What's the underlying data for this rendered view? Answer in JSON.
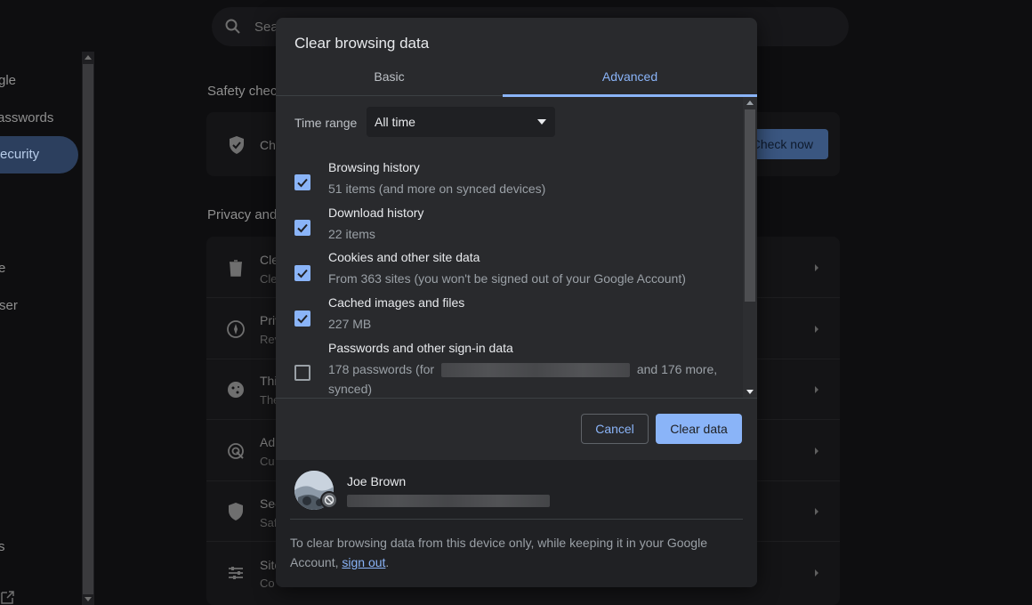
{
  "background": {
    "search_placeholder": "Sea",
    "sidebar_items": [
      "gle",
      "asswords",
      "ecurity",
      "e",
      "ser",
      "s"
    ],
    "safety_check_heading": "Safety chec",
    "safety_row_title": "Ch",
    "check_now_label": "Check now",
    "privacy_heading": "Privacy and",
    "privacy_rows": [
      {
        "title": "Cle",
        "sub": "Cle"
      },
      {
        "title": "Priv",
        "sub": "Rev"
      },
      {
        "title": "Thi",
        "sub": "The"
      },
      {
        "title": "Ad",
        "sub": "Cu"
      },
      {
        "title": "Sec",
        "sub": "Saf"
      },
      {
        "title": "Site",
        "sub": "Co"
      }
    ]
  },
  "dialog": {
    "title": "Clear browsing data",
    "tabs": [
      {
        "label": "Basic",
        "active": false
      },
      {
        "label": "Advanced",
        "active": true
      }
    ],
    "time_range": {
      "label": "Time range",
      "selected": "All time"
    },
    "items": [
      {
        "title": "Browsing history",
        "sub": "51 items (and more on synced devices)",
        "checked": true
      },
      {
        "title": "Download history",
        "sub": "22 items",
        "checked": true
      },
      {
        "title": "Cookies and other site data",
        "sub": "From 363 sites (you won't be signed out of your Google Account)",
        "checked": true
      },
      {
        "title": "Cached images and files",
        "sub": "227 MB",
        "checked": true
      },
      {
        "title": "Passwords and other sign-in data",
        "sub_prefix": "178 passwords (for",
        "sub_suffix": "and 176 more,",
        "sub_line2": "synced)",
        "checked": false
      }
    ],
    "cancel_label": "Cancel",
    "clear_label": "Clear data"
  },
  "account": {
    "name": "Joe Brown",
    "footer_text": "To clear browsing data from this device only, while keeping it in your Google Account,",
    "sign_out_link": "sign out",
    "footer_end": "."
  },
  "colors": {
    "accent": "#8ab4f8",
    "dialog_bg": "#292a2d",
    "page_bg": "#0e0e10"
  }
}
